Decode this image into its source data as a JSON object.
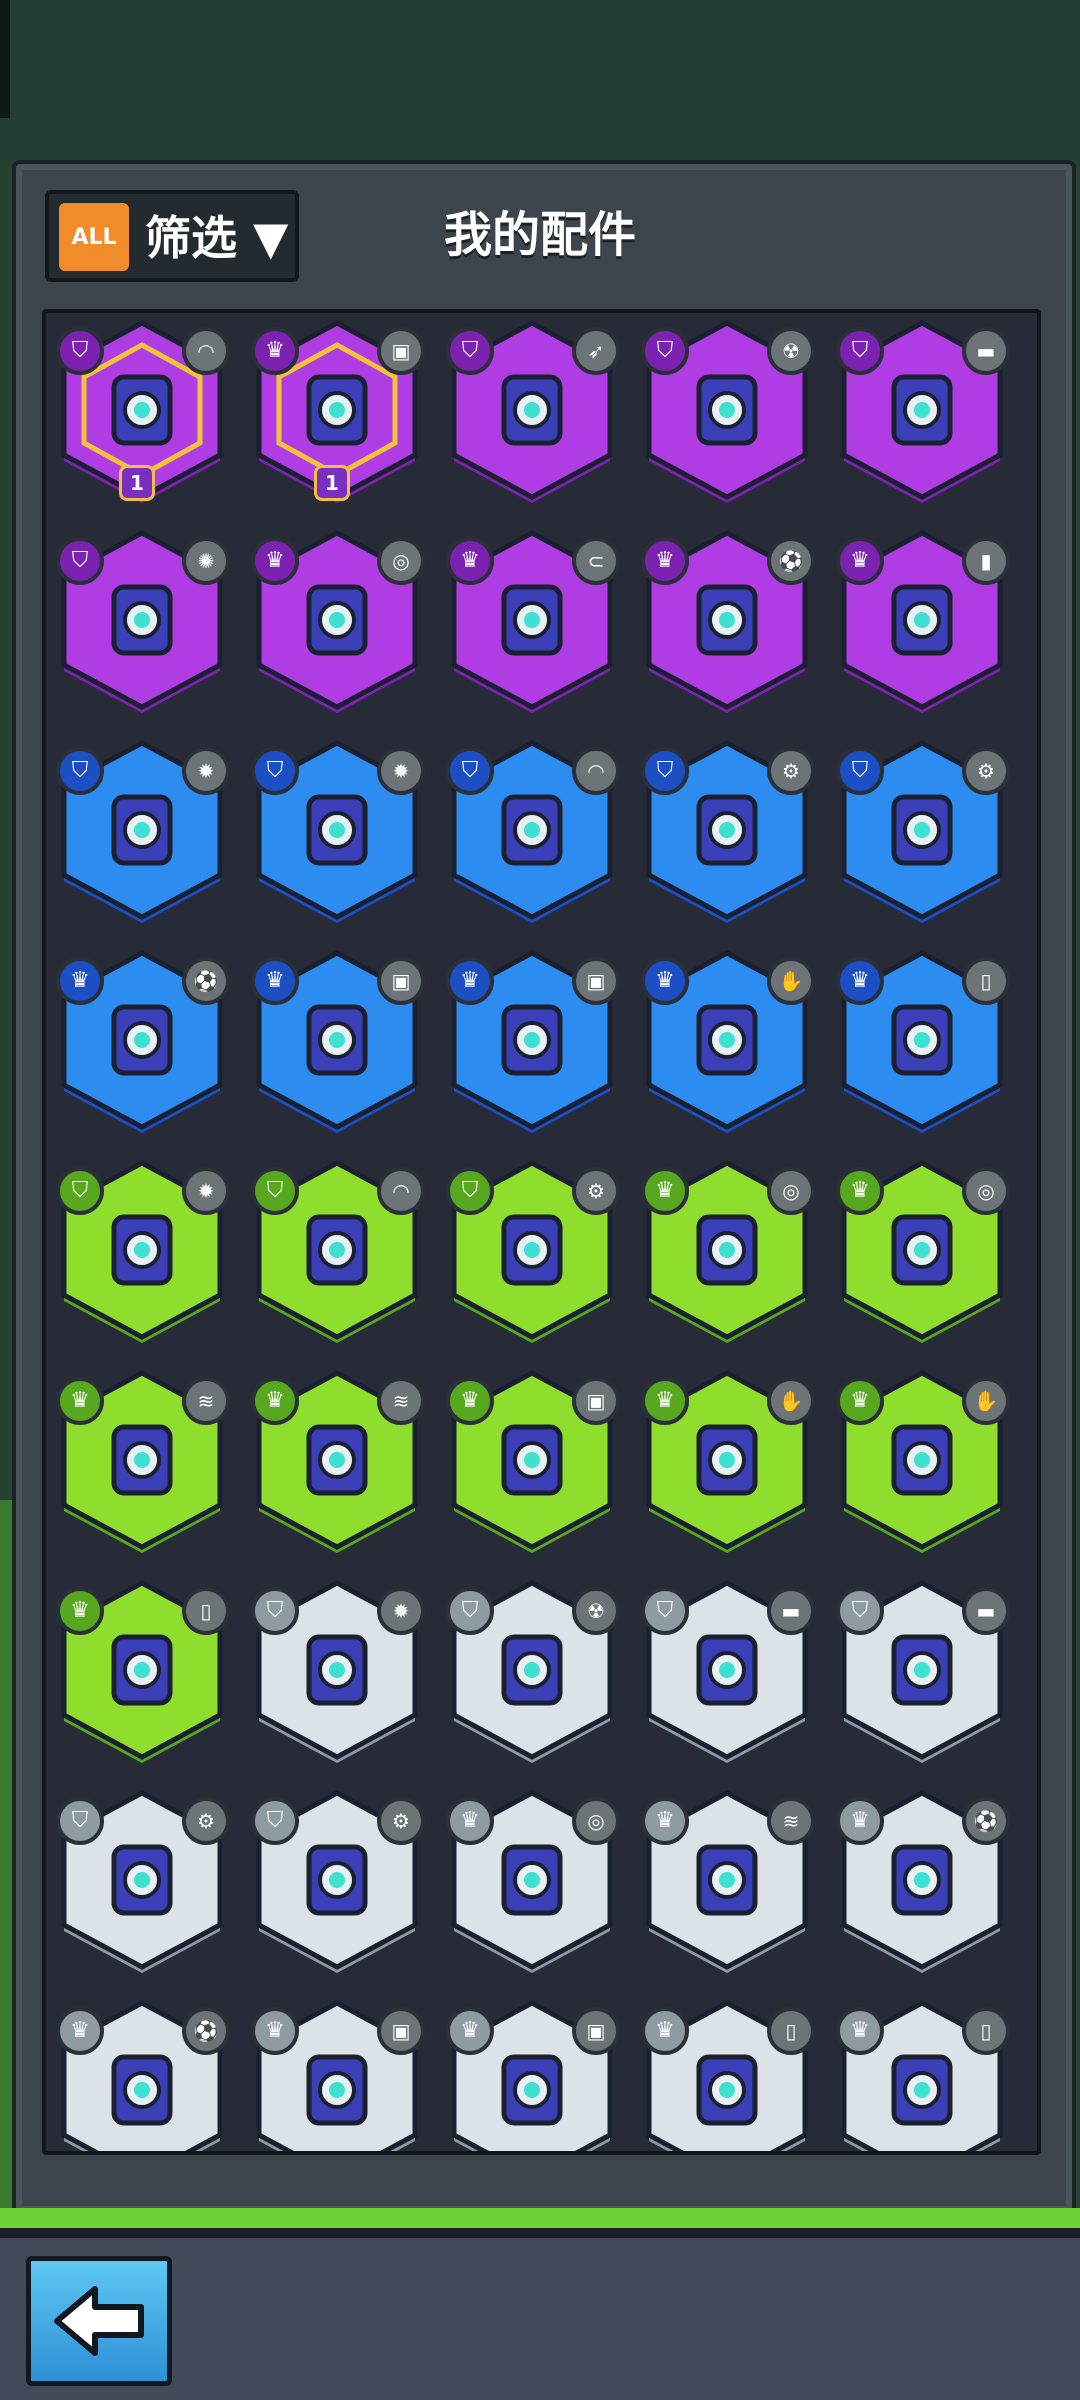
{
  "header": {
    "all_label": "ALL",
    "filter_label": "筛选 ▼",
    "title": "我的配件"
  },
  "colors": {
    "purple": "#b03de3",
    "purple_dark": "#7b22b0",
    "blue": "#2c8cf0",
    "blue_dark": "#1c4fc4",
    "green": "#8fde2e",
    "green_dark": "#57a81e",
    "gray": "#dce3e8",
    "gray_dark": "#8f9ba3",
    "selected_border": "#f2c23a",
    "accent_orange": "#f08c2a"
  },
  "icons": {
    "shield": "shield-icon",
    "crown": "crown-icon"
  },
  "parts": [
    {
      "rarity": "purple",
      "type": "shield",
      "element": "boomerang",
      "selected": true,
      "level": "1"
    },
    {
      "rarity": "purple",
      "type": "crown",
      "element": "camera",
      "selected": true,
      "level": "1"
    },
    {
      "rarity": "purple",
      "type": "shield",
      "element": "rocket"
    },
    {
      "rarity": "purple",
      "type": "shield",
      "element": "radioactive"
    },
    {
      "rarity": "purple",
      "type": "shield",
      "element": "brick"
    },
    {
      "rarity": "purple",
      "type": "shield",
      "element": "virus"
    },
    {
      "rarity": "purple",
      "type": "crown",
      "element": "drill"
    },
    {
      "rarity": "purple",
      "type": "crown",
      "element": "magnet"
    },
    {
      "rarity": "purple",
      "type": "crown",
      "element": "soccer-ball"
    },
    {
      "rarity": "purple",
      "type": "crown",
      "element": "battery"
    },
    {
      "rarity": "blue",
      "type": "shield",
      "element": "grenade"
    },
    {
      "rarity": "blue",
      "type": "shield",
      "element": "grenade"
    },
    {
      "rarity": "blue",
      "type": "shield",
      "element": "boomerang"
    },
    {
      "rarity": "blue",
      "type": "shield",
      "element": "gear"
    },
    {
      "rarity": "blue",
      "type": "shield",
      "element": "gear"
    },
    {
      "rarity": "blue",
      "type": "crown",
      "element": "soccer-ball"
    },
    {
      "rarity": "blue",
      "type": "crown",
      "element": "camera"
    },
    {
      "rarity": "blue",
      "type": "crown",
      "element": "camera"
    },
    {
      "rarity": "blue",
      "type": "crown",
      "element": "claw"
    },
    {
      "rarity": "blue",
      "type": "crown",
      "element": "bottle"
    },
    {
      "rarity": "green",
      "type": "shield",
      "element": "grenade"
    },
    {
      "rarity": "green",
      "type": "shield",
      "element": "boomerang"
    },
    {
      "rarity": "green",
      "type": "shield",
      "element": "gear"
    },
    {
      "rarity": "green",
      "type": "crown",
      "element": "drill"
    },
    {
      "rarity": "green",
      "type": "crown",
      "element": "drill"
    },
    {
      "rarity": "green",
      "type": "crown",
      "element": "spring"
    },
    {
      "rarity": "green",
      "type": "crown",
      "element": "spring"
    },
    {
      "rarity": "green",
      "type": "crown",
      "element": "camera"
    },
    {
      "rarity": "green",
      "type": "crown",
      "element": "claw"
    },
    {
      "rarity": "green",
      "type": "crown",
      "element": "claw"
    },
    {
      "rarity": "green",
      "type": "crown",
      "element": "bottle"
    },
    {
      "rarity": "gray",
      "type": "shield",
      "element": "grenade"
    },
    {
      "rarity": "gray",
      "type": "shield",
      "element": "radioactive"
    },
    {
      "rarity": "gray",
      "type": "shield",
      "element": "brick"
    },
    {
      "rarity": "gray",
      "type": "shield",
      "element": "brick"
    },
    {
      "rarity": "gray",
      "type": "shield",
      "element": "gear"
    },
    {
      "rarity": "gray",
      "type": "shield",
      "element": "gear"
    },
    {
      "rarity": "gray",
      "type": "crown",
      "element": "drill"
    },
    {
      "rarity": "gray",
      "type": "crown",
      "element": "spring"
    },
    {
      "rarity": "gray",
      "type": "crown",
      "element": "soccer-ball"
    },
    {
      "rarity": "gray",
      "type": "crown",
      "element": "soccer-ball"
    },
    {
      "rarity": "gray",
      "type": "crown",
      "element": "camera"
    },
    {
      "rarity": "gray",
      "type": "crown",
      "element": "camera"
    },
    {
      "rarity": "gray",
      "type": "crown",
      "element": "bottle"
    },
    {
      "rarity": "gray",
      "type": "crown",
      "element": "bottle"
    }
  ]
}
